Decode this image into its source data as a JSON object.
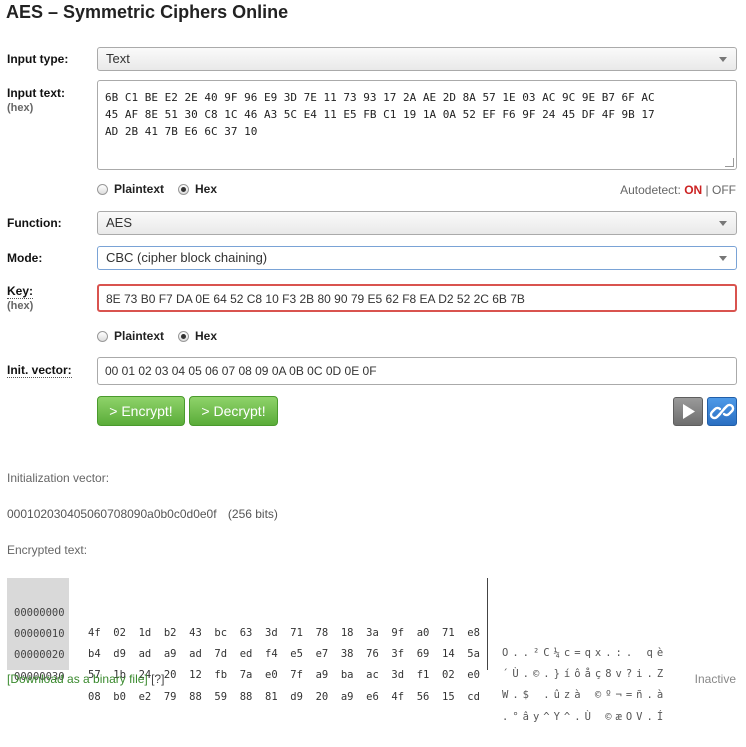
{
  "page_title": "AES – Symmetric Ciphers Online",
  "input_type": {
    "label": "Input type:",
    "value": "Text"
  },
  "input_text": {
    "label": "Input text:",
    "sub": "(hex)",
    "lines": [
      "6B C1 BE E2 2E 40 9F 96 E9 3D 7E 11 73 93 17 2A AE 2D 8A 57 1E 03 AC 9C 9E B7 6F AC",
      "45 AF 8E 51 30 C8 1C 46 A3 5C E4 11 E5 FB C1 19 1A 0A 52 EF F6 9F 24 45 DF 4F 9B 17",
      "AD 2B 41 7B E6 6C 37 10"
    ]
  },
  "text_format": {
    "plaintext": "Plaintext",
    "hex": "Hex"
  },
  "autodetect": {
    "label": "Autodetect:",
    "on": "ON",
    "sep": "|",
    "off": "OFF"
  },
  "function": {
    "label": "Function:",
    "value": "AES"
  },
  "mode": {
    "label": "Mode:",
    "value": "CBC (cipher block chaining)"
  },
  "key": {
    "label": "Key:",
    "sub": "(hex)",
    "value": "8E 73 B0 F7 DA 0E 64 52 C8 10 F3 2B 80 90 79 E5 62 F8 EA D2 52 2C 6B 7B"
  },
  "key_format": {
    "plaintext": "Plaintext",
    "hex": "Hex"
  },
  "iv": {
    "label": "Init. vector:",
    "value": "00 01 02 03 04 05 06 07 08 09 0A 0B 0C 0D 0E 0F"
  },
  "buttons": {
    "encrypt": "> Encrypt!",
    "decrypt": "> Decrypt!"
  },
  "icons": {
    "play": "play-icon",
    "link": "link-icon"
  },
  "colors": {
    "green": "#5aac39",
    "blue": "#2f7fd6",
    "red": "#cc2222"
  },
  "output": {
    "iv_label": "Initialization vector:",
    "iv_value": "000102030405060708090a0b0c0d0e0f",
    "iv_bits": "(256 bits)",
    "enc_label": "Encrypted text:",
    "rows": [
      {
        "offset": "00000000",
        "bytes": "4f  02  1d  b2  43  bc  63  3d  71  78  18  3a  9f  a0  71  e8",
        "ascii": "O..²C¼c=qx.:. qè"
      },
      {
        "offset": "00000010",
        "bytes": "b4  d9  ad  a9  ad  7d  ed  f4  e5  e7  38  76  3f  69  14  5a",
        "ascii": "´Ù.©.}íôåç8v?i.Z"
      },
      {
        "offset": "00000020",
        "bytes": "57  1b  24  20  12  fb  7a  e0  7f  a9  ba  ac  3d  f1  02  e0",
        "ascii": "W.$ .ûzà ©º¬=ñ.à"
      },
      {
        "offset": "00000030",
        "bytes": "08  b0  e2  79  88  59  88  81  d9  20  a9  e6  4f  56  15  cd",
        "ascii": ".°ây^Y^.Ù ©æOV.Í"
      }
    ],
    "download": "[Download as a binary file]",
    "help": "[?]",
    "status": "Inactive"
  }
}
